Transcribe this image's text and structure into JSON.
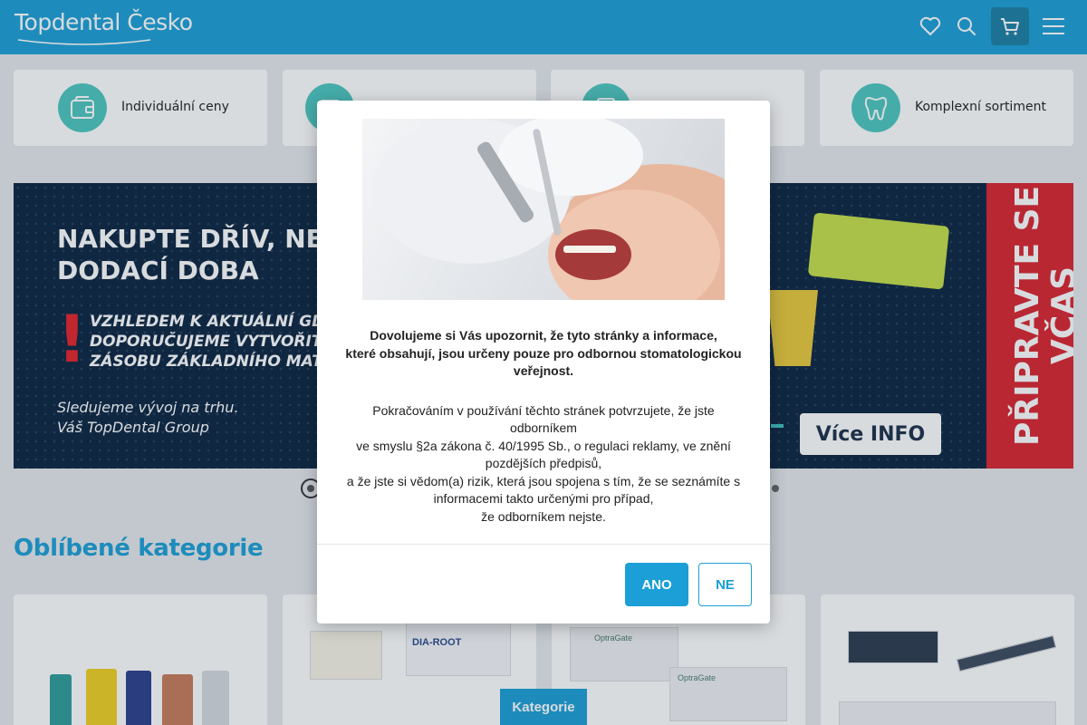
{
  "header": {
    "logo": "Topdental Česko",
    "icons": [
      "heart-icon",
      "search-icon",
      "cart-icon",
      "menu-icon"
    ]
  },
  "benefits": [
    {
      "label": "Individuální ceny",
      "icon": "wallet-icon"
    },
    {
      "label": "",
      "icon": "box-icon"
    },
    {
      "label": "",
      "icon": "badge-icon"
    },
    {
      "label": "Komplexní sortiment",
      "icon": "tooth-icon"
    }
  ],
  "banner": {
    "headline_1": "NAKUPTE DŘÍV, NEŽ",
    "headline_2": "DODACÍ DOBA",
    "sub_1": "VZHLEDEM K AKTUÁLNÍ GLO",
    "sub_2": "DOPORUČUJEME VYTVOŘIT",
    "sub_3": "ZÁSOBU ZÁKLADNÍHO MAT",
    "sign_1": "Sledujeme vývoj na trhu.",
    "sign_2": "Váš TopDental Group",
    "side_text_1": "PŘIPRAVTE SE",
    "side_text_2": "VČAS",
    "cta": "Více INFO"
  },
  "categories": {
    "title": "Oblíbené kategorie",
    "items": [
      {
        "products": [
          "DIA-ROOT"
        ]
      },
      {
        "products": [
          "OptraGate",
          "OptraGate"
        ]
      }
    ]
  },
  "bottom_bar": {
    "label": "Kategorie"
  },
  "modal": {
    "notice_1": "Dovolujeme si Vás upozornit, že tyto stránky a informace,",
    "notice_2": "které obsahují, jsou určeny pouze pro odbornou stomatologickou veřejnost.",
    "body_1": "Pokračováním v používání těchto stránek potvrzujete, že jste odborníkem",
    "body_2": "ve smyslu §2a zákona č. 40/1995 Sb., o regulaci reklamy, ve znění pozdějších předpisů,",
    "body_3": "a že jste si vědom(a) rizik, která jsou spojena s tím, že se seznámíte s informacemi takto určenými pro případ,",
    "body_4": "že odborníkem nejste.",
    "yes": "ANO",
    "no": "NE"
  },
  "colors": {
    "brand": "#1b9fd6",
    "accent": "#4cc6bf",
    "banner_bg": "#0c2440",
    "banner_red": "#d9242f"
  }
}
